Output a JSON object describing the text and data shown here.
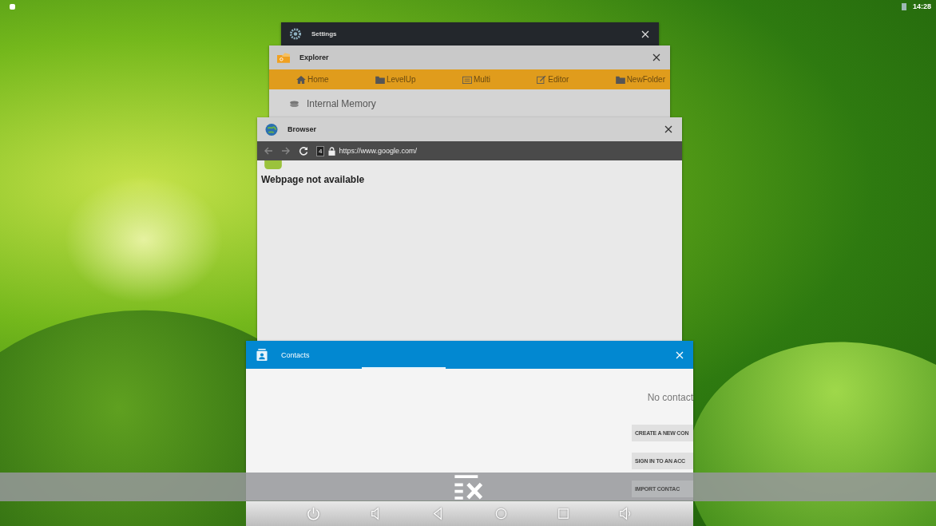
{
  "status_bar": {
    "time": "14:28"
  },
  "recents": [
    {
      "kind": "settings",
      "title": "Settings"
    },
    {
      "kind": "explorer",
      "title": "Explorer",
      "toolbar": [
        "Home",
        "LevelUp",
        "Multi",
        "Editor",
        "NewFolder"
      ],
      "location": "Internal Memory"
    },
    {
      "kind": "browser",
      "title": "Browser",
      "tab_count": "4",
      "url": "https://www.google.com/",
      "heading": "Webpage not available"
    },
    {
      "kind": "contacts",
      "title": "Contacts",
      "message": "No contact",
      "buttons": [
        "CREATE A NEW CON",
        "SIGN IN TO AN ACC",
        "IMPORT CONTAC"
      ]
    }
  ]
}
